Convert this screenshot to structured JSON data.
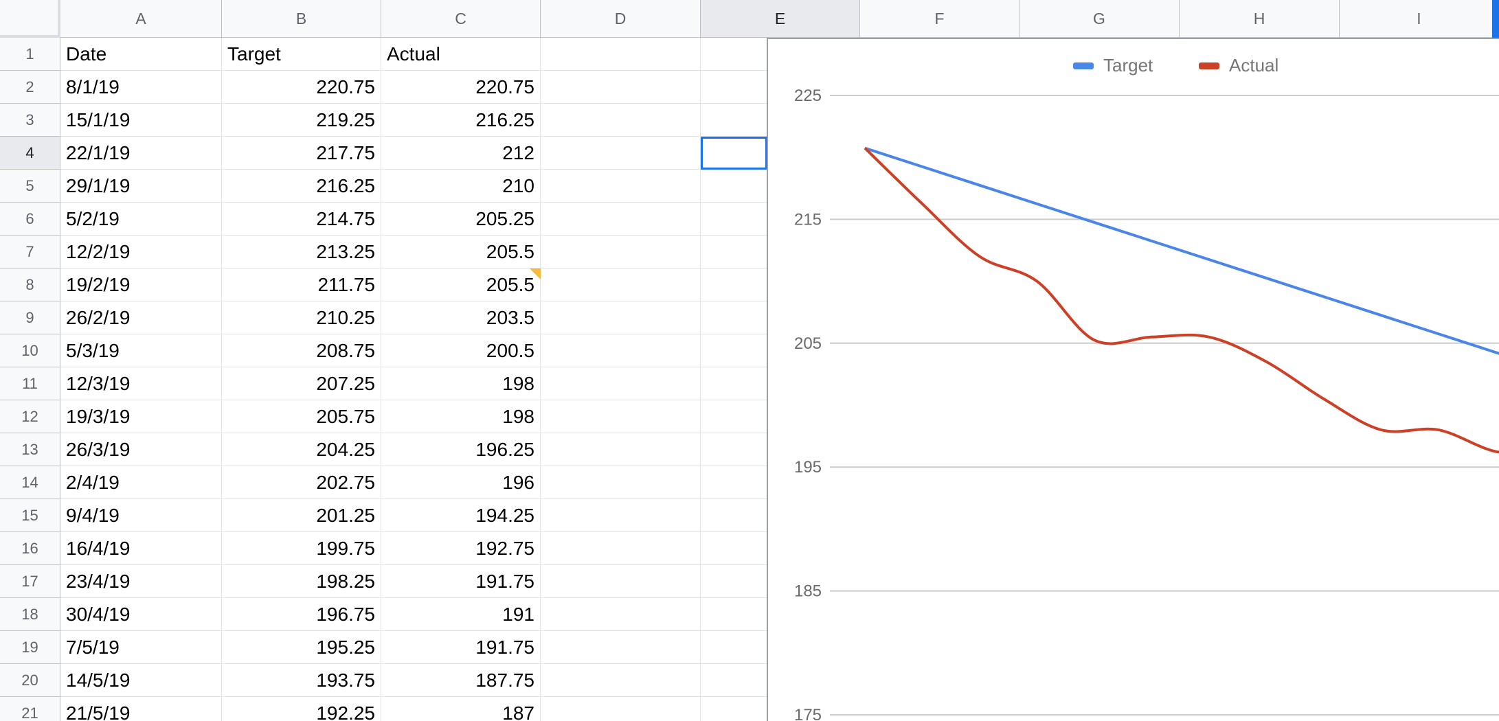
{
  "columns": [
    "A",
    "B",
    "C",
    "D",
    "E",
    "F",
    "G",
    "H",
    "I"
  ],
  "selected_column": "E",
  "selected_row": "4",
  "headers": [
    "Date",
    "Target",
    "Actual"
  ],
  "rows": [
    {
      "n": "1",
      "date": "Date",
      "target": "Target",
      "actual": "Actual"
    },
    {
      "n": "2",
      "date": "8/1/19",
      "target": "220.75",
      "actual": "220.75"
    },
    {
      "n": "3",
      "date": "15/1/19",
      "target": "219.25",
      "actual": "216.25"
    },
    {
      "n": "4",
      "date": "22/1/19",
      "target": "217.75",
      "actual": "212"
    },
    {
      "n": "5",
      "date": "29/1/19",
      "target": "216.25",
      "actual": "210"
    },
    {
      "n": "6",
      "date": "5/2/19",
      "target": "214.75",
      "actual": "205.25"
    },
    {
      "n": "7",
      "date": "12/2/19",
      "target": "213.25",
      "actual": "205.5"
    },
    {
      "n": "8",
      "date": "19/2/19",
      "target": "211.75",
      "actual": "205.5"
    },
    {
      "n": "9",
      "date": "26/2/19",
      "target": "210.25",
      "actual": "203.5"
    },
    {
      "n": "10",
      "date": "5/3/19",
      "target": "208.75",
      "actual": "200.5"
    },
    {
      "n": "11",
      "date": "12/3/19",
      "target": "207.25",
      "actual": "198"
    },
    {
      "n": "12",
      "date": "19/3/19",
      "target": "205.75",
      "actual": "198"
    },
    {
      "n": "13",
      "date": "26/3/19",
      "target": "204.25",
      "actual": "196.25"
    },
    {
      "n": "14",
      "date": "2/4/19",
      "target": "202.75",
      "actual": "196"
    },
    {
      "n": "15",
      "date": "9/4/19",
      "target": "201.25",
      "actual": "194.25"
    },
    {
      "n": "16",
      "date": "16/4/19",
      "target": "199.75",
      "actual": "192.75"
    },
    {
      "n": "17",
      "date": "23/4/19",
      "target": "198.25",
      "actual": "191.75"
    },
    {
      "n": "18",
      "date": "30/4/19",
      "target": "196.75",
      "actual": "191"
    },
    {
      "n": "19",
      "date": "7/5/19",
      "target": "195.25",
      "actual": "191.75"
    },
    {
      "n": "20",
      "date": "14/5/19",
      "target": "193.75",
      "actual": "187.75"
    },
    {
      "n": "21",
      "date": "21/5/19",
      "target": "192.25",
      "actual": "187"
    }
  ],
  "chart_data": {
    "type": "line",
    "x": [
      "8/1/19",
      "15/1/19",
      "22/1/19",
      "29/1/19",
      "5/2/19",
      "12/2/19",
      "19/2/19",
      "26/2/19",
      "5/3/19",
      "12/3/19",
      "19/3/19",
      "26/3/19",
      "2/4/19",
      "9/4/19",
      "16/4/19",
      "23/4/19",
      "30/4/19",
      "7/5/19",
      "14/5/19",
      "21/5/19"
    ],
    "series": [
      {
        "name": "Target",
        "color": "#4a86e8",
        "values": [
          220.75,
          219.25,
          217.75,
          216.25,
          214.75,
          213.25,
          211.75,
          210.25,
          208.75,
          207.25,
          205.75,
          204.25,
          202.75,
          201.25,
          199.75,
          198.25,
          196.75,
          195.25,
          193.75,
          192.25
        ]
      },
      {
        "name": "Actual",
        "color": "#cc4125",
        "values": [
          220.75,
          216.25,
          212,
          210,
          205.25,
          205.5,
          205.5,
          203.5,
          200.5,
          198,
          198,
          196.25,
          196,
          194.25,
          192.75,
          191.75,
          191,
          191.75,
          187.75,
          187
        ]
      }
    ],
    "yticks": [
      "225",
      "215",
      "205",
      "195",
      "185",
      "175"
    ],
    "ylim": [
      175,
      225
    ],
    "grid": true,
    "legend": "top"
  },
  "colors": {
    "target": "#4a86e8",
    "actual": "#cc4125",
    "selection": "#1a73e8",
    "gridline": "#cccccc",
    "comment": "#f6b93b"
  }
}
